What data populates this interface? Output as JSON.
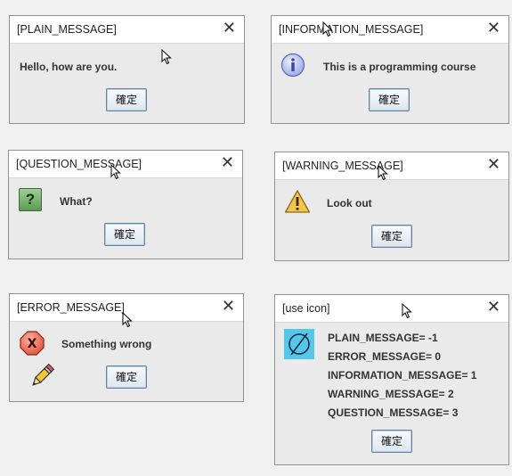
{
  "dialogs": {
    "plain": {
      "title": "[PLAIN_MESSAGE]",
      "message": "Hello, how are you.",
      "ok": "確定"
    },
    "information": {
      "title": "[INFORMATION_MESSAGE]",
      "message": "This is a programming course",
      "ok": "確定"
    },
    "question": {
      "title": "[QUESTION_MESSAGE]",
      "message": "What?",
      "ok": "確定",
      "icon_glyph": "?"
    },
    "warning": {
      "title": "[WARNING_MESSAGE]",
      "message": "Look out",
      "ok": "確定",
      "icon_glyph": "!"
    },
    "error": {
      "title": "[ERROR_MESSAGE]",
      "message": "Something wrong",
      "ok": "確定",
      "icon_glyph": "X"
    },
    "use_icon": {
      "title": "[use icon]",
      "lines": [
        "PLAIN_MESSAGE= -1",
        "ERROR_MESSAGE= 0",
        "INFORMATION_MESSAGE= 1",
        "WARNING_MESSAGE= 2",
        "QUESTION_MESSAGE= 3"
      ],
      "ok": "確定"
    }
  },
  "close_glyph": "✕",
  "icons": {
    "information": "info-icon",
    "question": "question-icon",
    "warning": "warning-icon",
    "error": "error-icon",
    "pencil": "pencil-icon",
    "custom": "empty-set-icon",
    "cursor": "mouse-cursor-icon"
  },
  "colors": {
    "button_border": "#6e8094",
    "question_icon": "#6fa46a",
    "warning_icon": "#f2c24b",
    "error_icon": "#e8684f",
    "info_icon": "#aab4ea",
    "custom_icon_bg": "#4fc8e8"
  }
}
